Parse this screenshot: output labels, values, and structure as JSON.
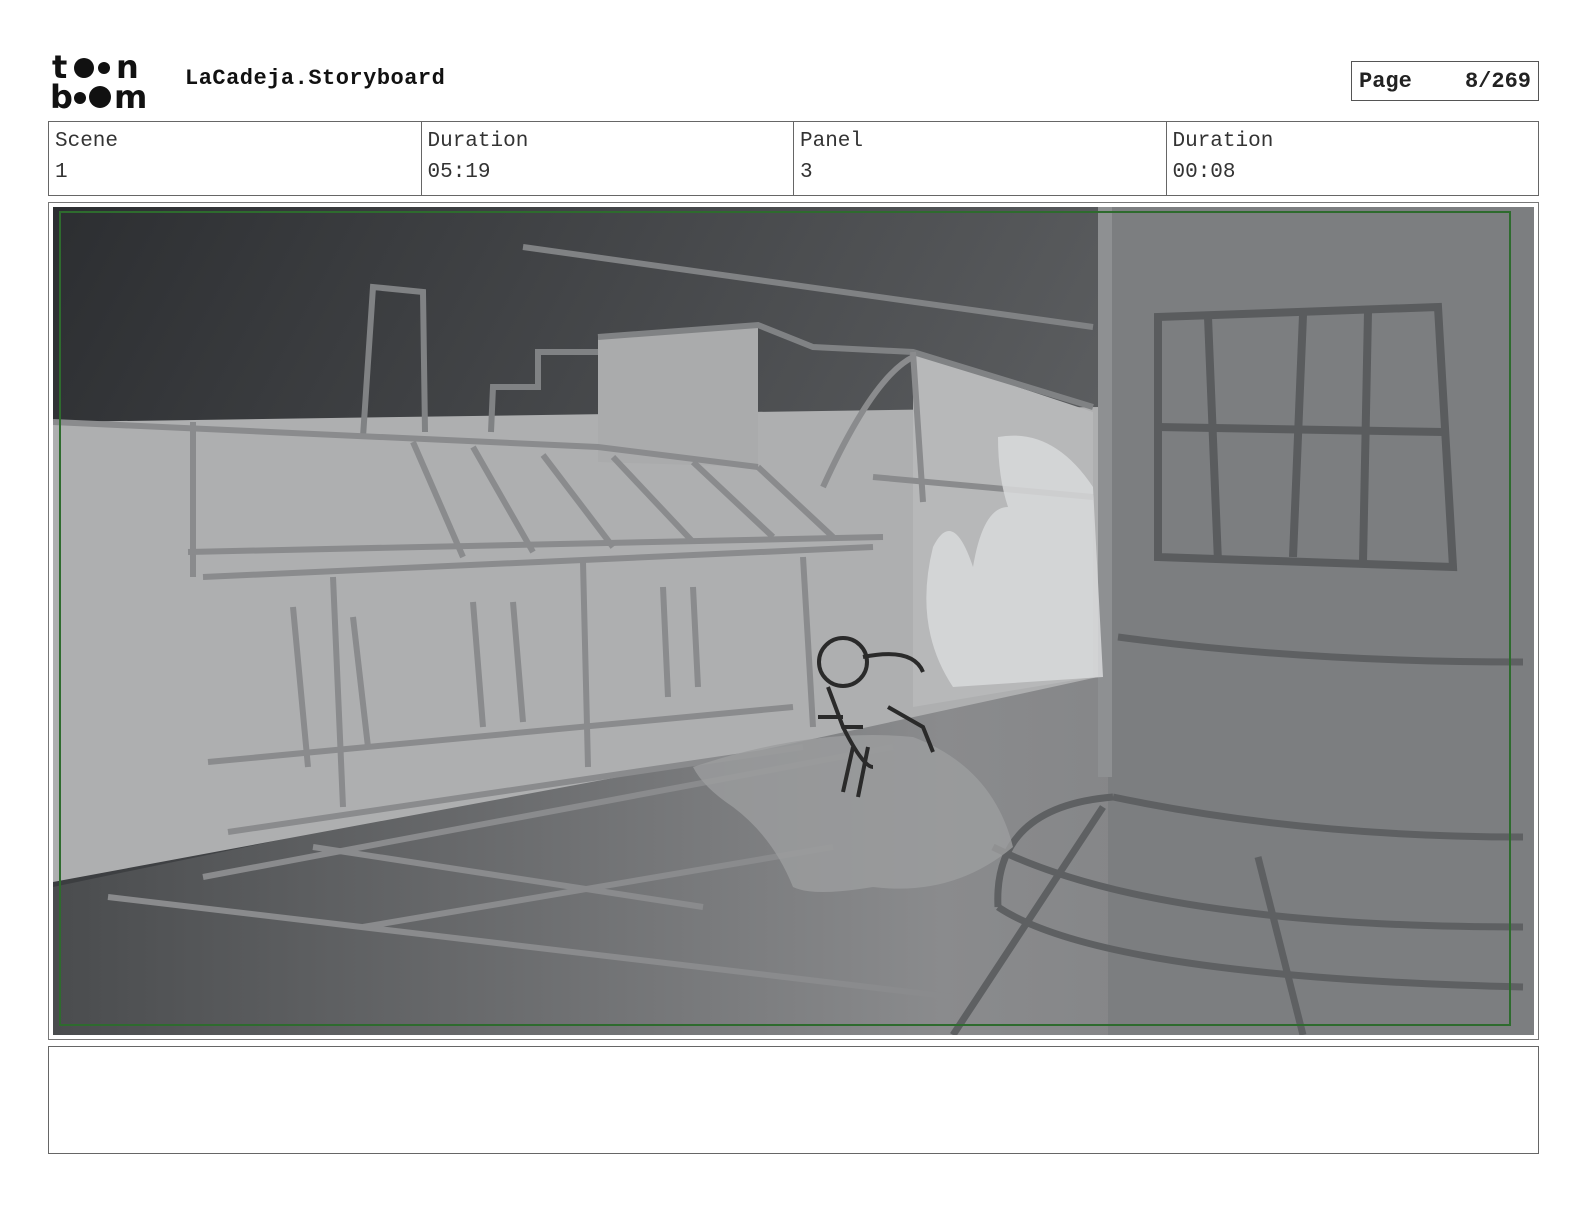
{
  "header": {
    "project_title": "LaCadeja.Storyboard",
    "page_label": "Page",
    "page_value": "8/269",
    "logo_text": "toonboom"
  },
  "info": {
    "scene_label": "Scene",
    "scene_value": "1",
    "scene_duration_label": "Duration",
    "scene_duration_value": "05:19",
    "panel_label": "Panel",
    "panel_value": "3",
    "panel_duration_label": "Duration",
    "panel_duration_value": "00:08"
  },
  "panel": {
    "safe_frame_color": "#2e6b2e"
  },
  "notes": {
    "text": ""
  }
}
